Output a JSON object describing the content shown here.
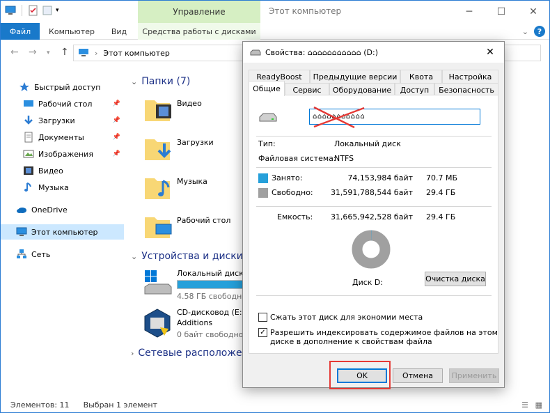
{
  "explorer": {
    "title": "Этот компьютер",
    "context_tab_header": "Управление",
    "ribbon_tabs": {
      "file": "Файл",
      "computer": "Компьютер",
      "view": "Вид",
      "drive_tools": "Средства работы с дисками"
    },
    "address": "Этот компьютер",
    "sidebar": {
      "quick_access": "Быстрый доступ",
      "desktop": "Рабочий стол",
      "downloads": "Загрузки",
      "documents": "Документы",
      "pictures": "Изображения",
      "videos": "Видео",
      "music": "Музыка",
      "onedrive": "OneDrive",
      "this_pc": "Этот компьютер",
      "network": "Сеть"
    },
    "content": {
      "folders_header": "Папки (7)",
      "folders": {
        "videos": "Видео",
        "downloads": "Загрузки",
        "music": "Музыка",
        "desktop": "Рабочий стол"
      },
      "devices_header": "Устройства и диски (3",
      "local_disk": {
        "label": "Локальный диск (",
        "free": "4.58 ГБ свободно",
        "used_fraction": 0.86
      },
      "cd_drive": {
        "label": "CD-дисковод (E:) V",
        "label2": "Additions",
        "free": "0 байт свободно"
      },
      "network_header": "Сетевые расположен"
    },
    "status": {
      "items": "Элементов: 11",
      "selected": "Выбран 1 элемент"
    }
  },
  "dialog": {
    "title": "Свойства: ⌂⌂⌂⌂⌂⌂⌂⌂⌂⌂⌂ (D:)",
    "tabs": {
      "readyboost": "ReadyBoost",
      "previous_versions": "Предыдущие версии",
      "quota": "Квота",
      "customize": "Настройка",
      "general": "Общие",
      "tools": "Сервис",
      "hardware": "Оборудование",
      "sharing": "Доступ",
      "security": "Безопасность"
    },
    "name_value": "⌂⌂⌂⌂⌂⌂⌂⌂⌂⌂⌂",
    "type_label": "Тип:",
    "type_value": "Локальный диск",
    "fs_label": "Файловая система:",
    "fs_value": "NTFS",
    "used_label": "Занято:",
    "used_bytes": "74,153,984 байт",
    "used_human": "70.7 МБ",
    "free_label": "Свободно:",
    "free_bytes": "31,591,788,544 байт",
    "free_human": "29.4 ГБ",
    "capacity_label": "Емкость:",
    "capacity_bytes": "31,665,942,528 байт",
    "capacity_human": "29.4 ГБ",
    "used_fraction": 0.0023,
    "disk_label": "Диск D:",
    "cleanup_button": "Очистка диска",
    "compress_label": "Сжать этот диск для экономии места",
    "compress_checked": false,
    "index_label_line1": "Разрешить индексировать содержимое файлов на этом",
    "index_label_line2": "диске в дополнение к свойствам файла",
    "index_checked": true,
    "ok": "OK",
    "cancel": "Отмена",
    "apply": "Применить",
    "colors": {
      "used": "#26a0da",
      "free": "#a0a0a0",
      "highlight": "#e53935"
    }
  }
}
